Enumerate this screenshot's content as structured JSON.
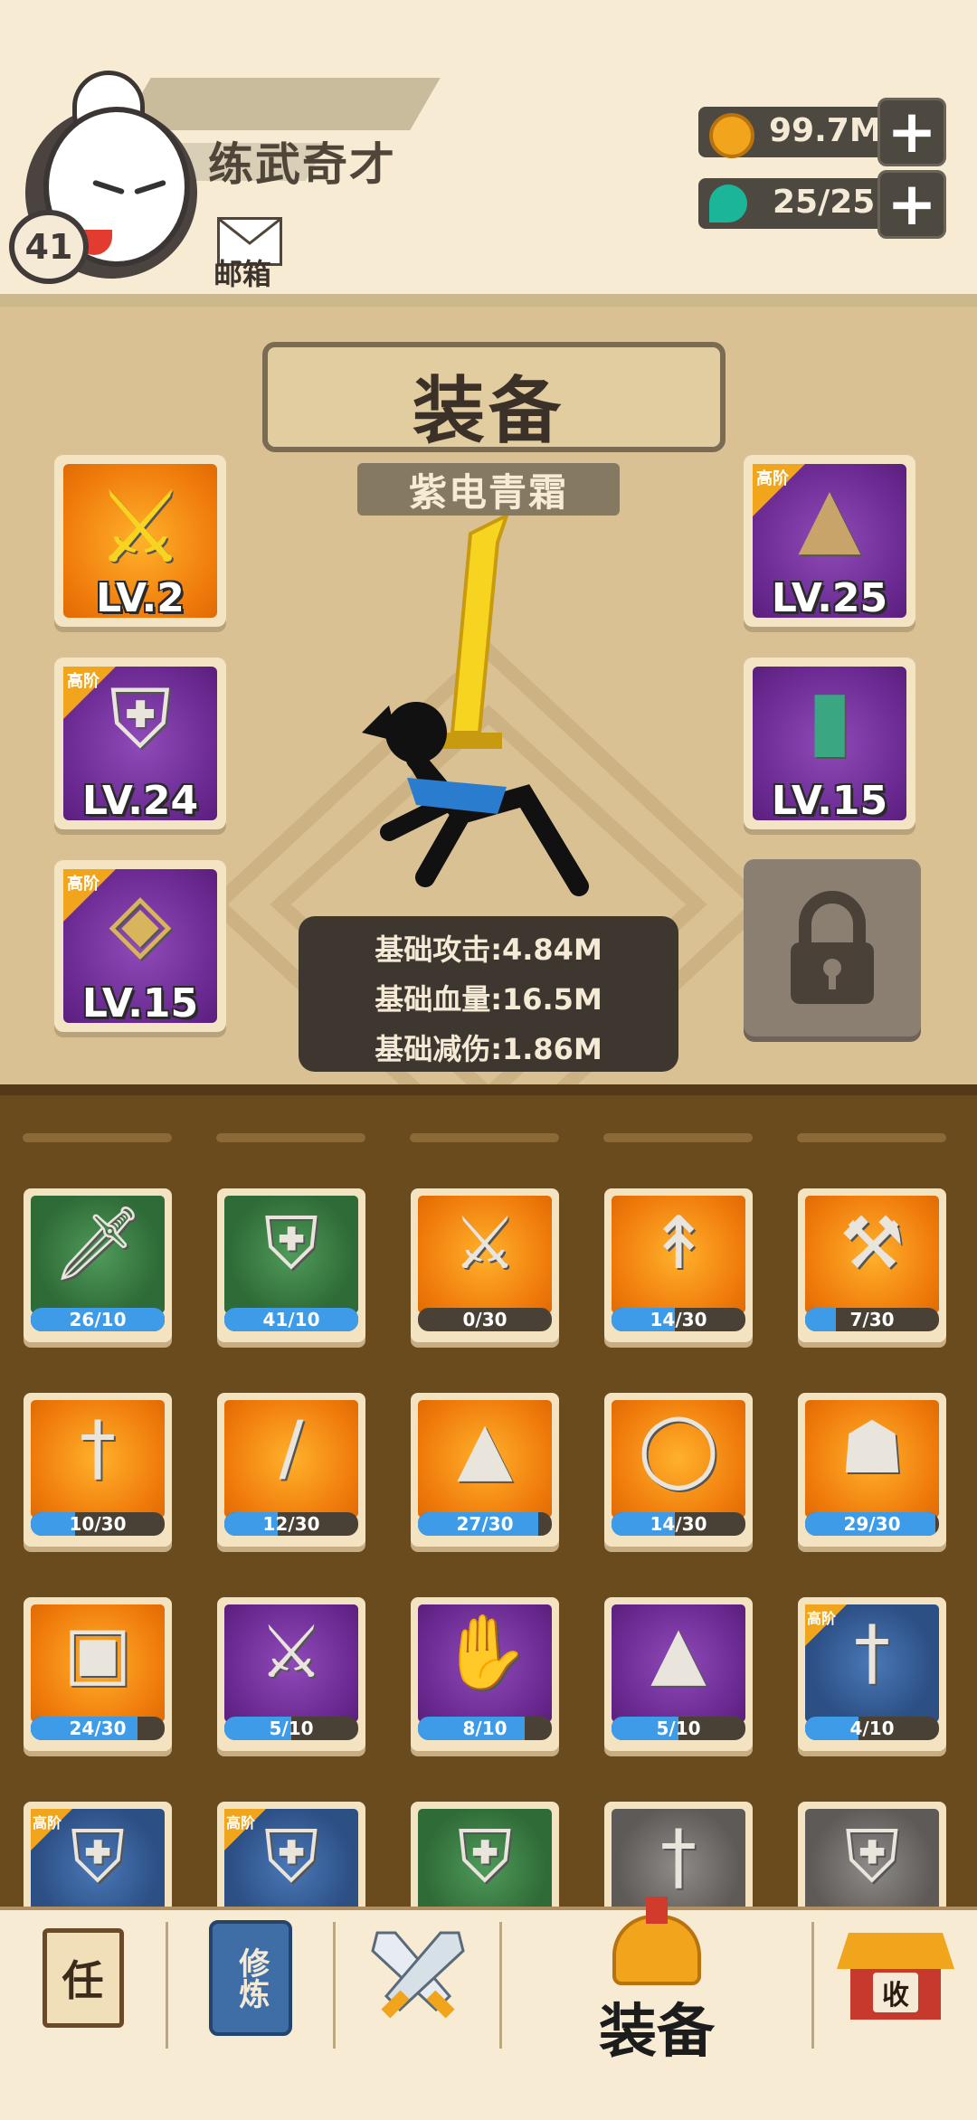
{
  "header": {
    "player_name": "练武奇才",
    "player_level": "41",
    "mail_label": "邮箱",
    "gold": "99.7M",
    "gems": "25/25"
  },
  "equip": {
    "title": "装备",
    "weapon_name": "紫电青霜",
    "slots": [
      {
        "level": "LV.2",
        "tier": ""
      },
      {
        "level": "LV.24",
        "tier": "高阶"
      },
      {
        "level": "LV.15",
        "tier": "高阶"
      },
      {
        "level": "LV.25",
        "tier": "高阶"
      },
      {
        "level": "LV.15",
        "tier": ""
      }
    ],
    "stats": [
      "基础攻击:4.84M",
      "基础血量:16.5M",
      "基础减伤:1.86M"
    ]
  },
  "inventory": {
    "items": [
      {
        "count": "26/10",
        "fill": 1.0,
        "color": "green",
        "icon": "cleaver-icon",
        "tier": ""
      },
      {
        "count": "41/10",
        "fill": 1.0,
        "color": "green",
        "icon": "armor-icon",
        "tier": ""
      },
      {
        "count": "0/30",
        "fill": 0.0,
        "color": "orange",
        "icon": "broadsword-icon",
        "tier": ""
      },
      {
        "count": "14/30",
        "fill": 0.47,
        "color": "orange",
        "icon": "spear-icon",
        "tier": ""
      },
      {
        "count": "7/30",
        "fill": 0.23,
        "color": "orange",
        "icon": "hammer-icon",
        "tier": ""
      },
      {
        "count": "10/30",
        "fill": 0.33,
        "color": "orange",
        "icon": "sword-icon",
        "tier": ""
      },
      {
        "count": "12/30",
        "fill": 0.4,
        "color": "orange",
        "icon": "staff-icon",
        "tier": ""
      },
      {
        "count": "27/30",
        "fill": 0.9,
        "color": "orange",
        "icon": "hat-icon",
        "tier": ""
      },
      {
        "count": "14/30",
        "fill": 0.47,
        "color": "orange",
        "icon": "bracelet-icon",
        "tier": ""
      },
      {
        "count": "29/30",
        "fill": 0.97,
        "color": "orange",
        "icon": "cloak-icon",
        "tier": ""
      },
      {
        "count": "24/30",
        "fill": 0.8,
        "color": "orange",
        "icon": "vest-icon",
        "tier": ""
      },
      {
        "count": "5/10",
        "fill": 0.5,
        "color": "purple",
        "icon": "jagged-sword-icon",
        "tier": ""
      },
      {
        "count": "8/10",
        "fill": 0.8,
        "color": "purple",
        "icon": "gauntlet-icon",
        "tier": ""
      },
      {
        "count": "5/10",
        "fill": 0.5,
        "color": "purple",
        "icon": "hat-icon",
        "tier": ""
      },
      {
        "count": "4/10",
        "fill": 0.4,
        "color": "blue",
        "icon": "sword-icon",
        "tier": "高阶"
      },
      {
        "count": "",
        "fill": 0,
        "color": "blue",
        "icon": "armor-icon",
        "tier": "高阶"
      },
      {
        "count": "",
        "fill": 0,
        "color": "blue",
        "icon": "armor-icon",
        "tier": "高阶"
      },
      {
        "count": "",
        "fill": 0,
        "color": "green",
        "icon": "armor-icon",
        "tier": ""
      },
      {
        "count": "",
        "fill": 0,
        "color": "gray",
        "icon": "sword-icon",
        "tier": ""
      },
      {
        "count": "",
        "fill": 0,
        "color": "gray",
        "icon": "armor-icon",
        "tier": ""
      }
    ]
  },
  "nav": {
    "quest_glyph": "任",
    "train_glyph": "修炼",
    "shop_glyph": "收",
    "active_label": "装备"
  }
}
